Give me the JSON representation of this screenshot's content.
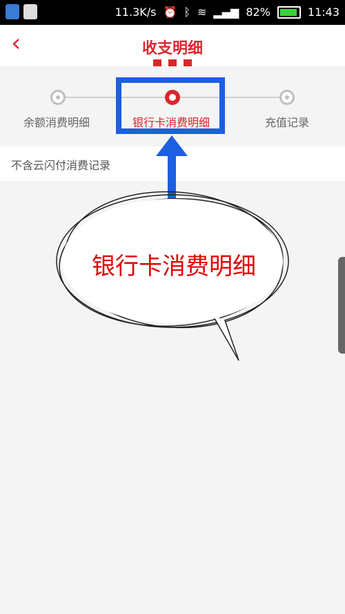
{
  "status_bar": {
    "speed": "11.3K/s",
    "battery": "82%",
    "time": "11:43"
  },
  "header": {
    "back_icon": "back-chevron-icon",
    "title": "收支明细"
  },
  "steps": [
    {
      "label": "余额消费明细",
      "active": false
    },
    {
      "label": "银行卡消费明细",
      "active": true
    },
    {
      "label": "充值记录",
      "active": false
    }
  ],
  "notice": {
    "text": "不含云闪付消费记录"
  },
  "annotation": {
    "bubble_text": "银行卡消费明细"
  },
  "colors": {
    "accent": "#d9262c",
    "highlight": "#1c5fe0"
  }
}
